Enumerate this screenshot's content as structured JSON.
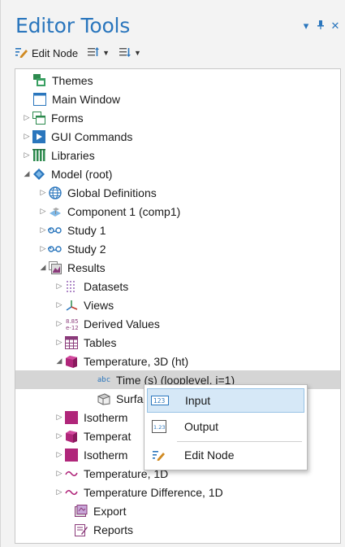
{
  "panel": {
    "title": "Editor Tools",
    "title_buttons": [
      "▾",
      "▪",
      "✕"
    ]
  },
  "toolbar": {
    "edit_node_label": "Edit Node"
  },
  "tree": {
    "items": [
      {
        "label": "Themes",
        "icon": "themes-icon"
      },
      {
        "label": "Main Window",
        "icon": "window-icon"
      },
      {
        "label": "Forms",
        "icon": "forms-icon"
      },
      {
        "label": "GUI Commands",
        "icon": "gui-commands-icon"
      },
      {
        "label": "Libraries",
        "icon": "libraries-icon"
      },
      {
        "label": "Model (root)",
        "icon": "model-icon"
      },
      {
        "label": "Global Definitions",
        "icon": "globe-icon"
      },
      {
        "label": "Component 1 (comp1)",
        "icon": "component-icon"
      },
      {
        "label": "Study 1",
        "icon": "study-icon"
      },
      {
        "label": "Study 2",
        "icon": "study-icon"
      },
      {
        "label": "Results",
        "icon": "results-icon"
      },
      {
        "label": "Datasets",
        "icon": "datasets-icon"
      },
      {
        "label": "Views",
        "icon": "views-icon"
      },
      {
        "label": "Derived Values",
        "icon": "derived-values-icon"
      },
      {
        "label": "Tables",
        "icon": "tables-icon"
      },
      {
        "label": "Temperature, 3D (ht)",
        "icon": "plot3d-icon"
      },
      {
        "label": "Time (s) (looplevel, i=1)",
        "icon": "abc-text-icon"
      },
      {
        "label": "Surfa",
        "icon": "surface-icon"
      },
      {
        "label": "Isotherm",
        "icon": "plot3d-icon"
      },
      {
        "label": "Temperat",
        "icon": "plot3d-icon"
      },
      {
        "label": "Isotherm",
        "icon": "plot3d-icon"
      },
      {
        "label": "Temperature, 1D",
        "icon": "plot1d-icon"
      },
      {
        "label": "Temperature Difference, 1D",
        "icon": "plot1d-icon"
      },
      {
        "label": "Export",
        "icon": "export-icon"
      },
      {
        "label": "Reports",
        "icon": "reports-icon"
      }
    ]
  },
  "context_menu": {
    "items": [
      {
        "label": "Input",
        "icon": "input-icon"
      },
      {
        "label": "Output",
        "icon": "output-icon"
      },
      {
        "label": "Edit Node",
        "icon": "edit-node-icon"
      }
    ]
  }
}
